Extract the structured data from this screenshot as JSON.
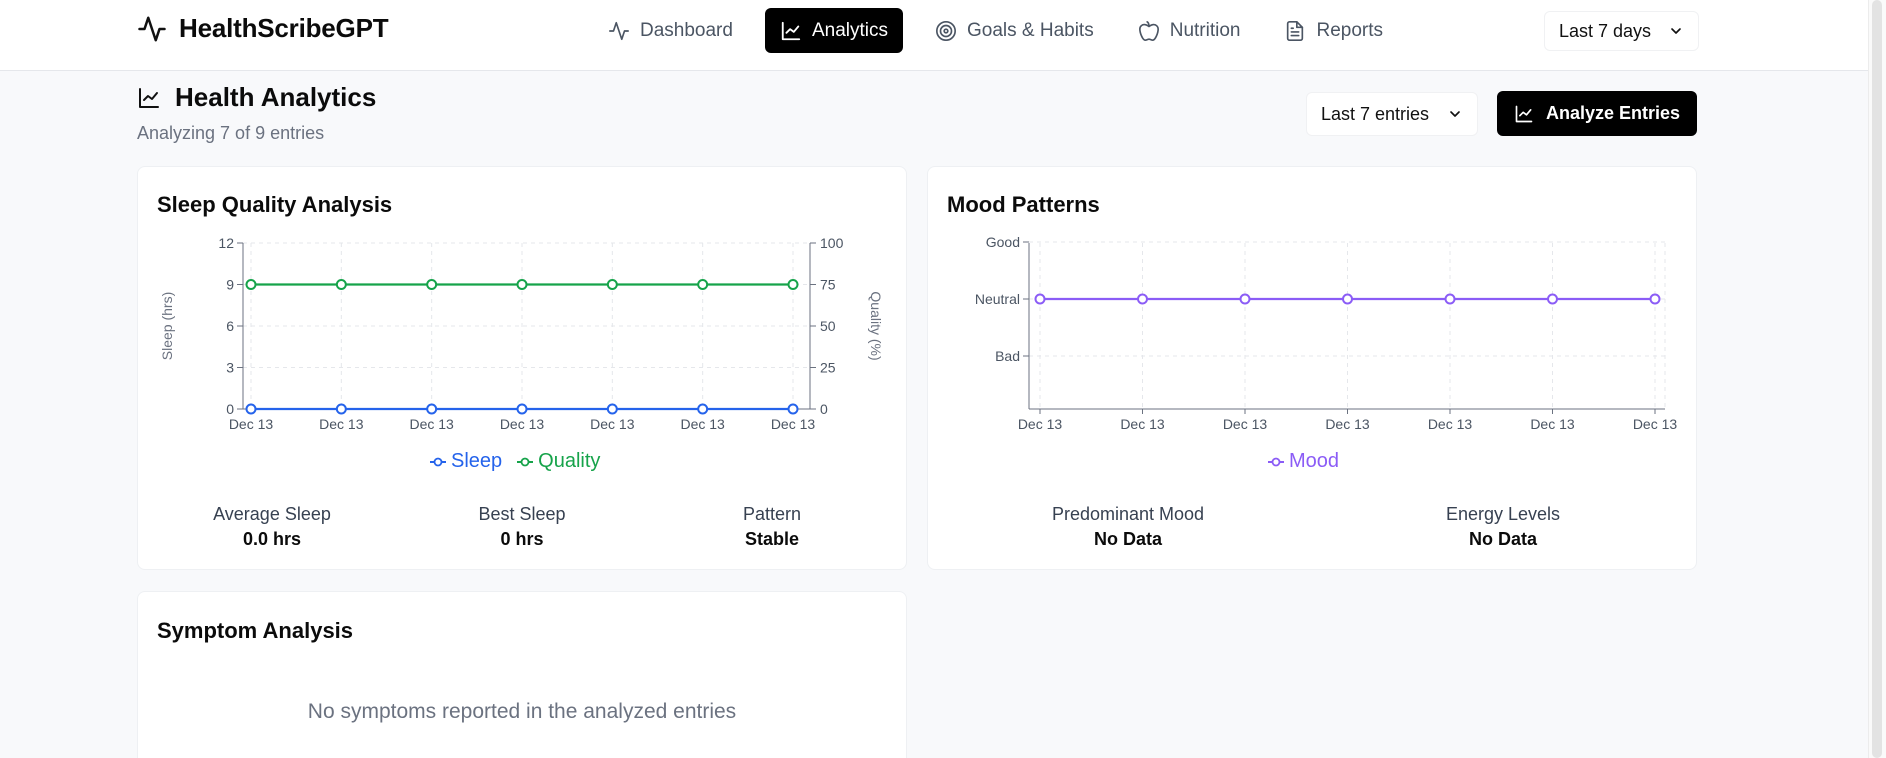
{
  "app": {
    "name": "HealthScribeGPT"
  },
  "nav": {
    "items": [
      {
        "label": "Dashboard",
        "icon": "activity-icon",
        "active": false
      },
      {
        "label": "Analytics",
        "icon": "line-chart-icon",
        "active": true
      },
      {
        "label": "Goals & Habits",
        "icon": "target-icon",
        "active": false
      },
      {
        "label": "Nutrition",
        "icon": "apple-icon",
        "active": false
      },
      {
        "label": "Reports",
        "icon": "file-text-icon",
        "active": false
      }
    ],
    "range_select": "Last 7 days"
  },
  "page": {
    "title": "Health Analytics",
    "subtitle": "Analyzing 7 of 9 entries",
    "entries_select": "Last 7 entries",
    "analyze_button": "Analyze Entries"
  },
  "sleep_card": {
    "title": "Sleep Quality Analysis",
    "stats": [
      {
        "label": "Average Sleep",
        "value": "0.0 hrs"
      },
      {
        "label": "Best Sleep",
        "value": "0 hrs"
      },
      {
        "label": "Pattern",
        "value": "Stable"
      }
    ]
  },
  "mood_card": {
    "title": "Mood Patterns",
    "stats": [
      {
        "label": "Predominant Mood",
        "value": "No Data"
      },
      {
        "label": "Energy Levels",
        "value": "No Data"
      }
    ]
  },
  "symptom_card": {
    "title": "Symptom Analysis",
    "empty_message": "No symptoms reported in the analyzed entries"
  },
  "colors": {
    "sleep": "#2563eb",
    "quality": "#16a34a",
    "mood": "#8b5cf6"
  },
  "chart_data": [
    {
      "type": "line",
      "x": [
        "Dec 13",
        "Dec 13",
        "Dec 13",
        "Dec 13",
        "Dec 13",
        "Dec 13",
        "Dec 13"
      ],
      "ylabel": "Sleep (hrs)",
      "ylim": [
        0,
        12
      ],
      "yticks": [
        0,
        3,
        6,
        9,
        12
      ],
      "y2label": "Quality (%)",
      "y2lim": [
        0,
        100
      ],
      "y2ticks": [
        0,
        25,
        50,
        75,
        100
      ],
      "grid": true,
      "legend": "bottom",
      "series": [
        {
          "name": "Sleep",
          "axis": "left",
          "values": [
            0,
            0,
            0,
            0,
            0,
            0,
            0
          ]
        },
        {
          "name": "Quality",
          "axis": "right",
          "values": [
            75,
            75,
            75,
            75,
            75,
            75,
            75
          ]
        }
      ]
    },
    {
      "type": "line",
      "x": [
        "Dec 13",
        "Dec 13",
        "Dec 13",
        "Dec 13",
        "Dec 13",
        "Dec 13",
        "Dec 13"
      ],
      "yticks": [
        "Bad",
        "Neutral",
        "Good"
      ],
      "grid": true,
      "legend": "bottom",
      "series": [
        {
          "name": "Mood",
          "values": [
            "Neutral",
            "Neutral",
            "Neutral",
            "Neutral",
            "Neutral",
            "Neutral",
            "Neutral"
          ]
        }
      ]
    }
  ]
}
